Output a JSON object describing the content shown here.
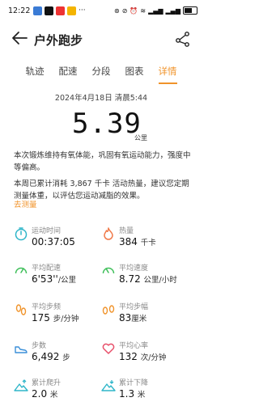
{
  "status_bar": {
    "time": "12:22",
    "battery_percent": 0.7
  },
  "header": {
    "title": "户外跑步"
  },
  "tabs": [
    {
      "label": "轨迹"
    },
    {
      "label": "配速"
    },
    {
      "label": "分段"
    },
    {
      "label": "图表"
    },
    {
      "label": "详情",
      "active": true
    }
  ],
  "summary": {
    "date_line": "2024年4月18日 清晨5:44",
    "distance": "5.39",
    "distance_unit": "公里",
    "paragraph1": "本次锻炼维持有氧体能，巩固有氧运动能力，强度中等偏高。",
    "paragraph2": "本周已累计消耗 3,867 千卡 活动热量，建议您定期测量体重，以评估您运动减脂的效果。",
    "link": "去测量"
  },
  "metrics": [
    {
      "label": "运动时间",
      "value": "00:37:05",
      "unit": "",
      "icon": "stopwatch-icon",
      "color": "#2fb6c9"
    },
    {
      "label": "热量",
      "value": "384",
      "unit": "千卡",
      "icon": "flame-icon",
      "color": "#f07a4a"
    },
    {
      "label": "平均配速",
      "value": "6'53''",
      "unit": "/公里",
      "icon": "pace-gauge-icon",
      "color": "#3fbf5a"
    },
    {
      "label": "平均速度",
      "value": "8.72",
      "unit": "公里/小时",
      "icon": "speed-gauge-icon",
      "color": "#3fbf5a"
    },
    {
      "label": "平均步频",
      "value": "175",
      "unit": "步/分钟",
      "icon": "footprints-icon",
      "color": "#f0932a"
    },
    {
      "label": "平均步幅",
      "value": "83",
      "unit": "厘米",
      "icon": "stride-icon",
      "color": "#f0932a"
    },
    {
      "label": "步数",
      "value": "6,492",
      "unit": "步",
      "icon": "shoe-icon",
      "color": "#3a8fd9"
    },
    {
      "label": "平均心率",
      "value": "132",
      "unit": "次/分钟",
      "icon": "heart-icon",
      "color": "#e8506a"
    },
    {
      "label": "累计爬升",
      "value": "2.0",
      "unit": "米",
      "icon": "mountain-up-icon",
      "color": "#2fb6c9"
    },
    {
      "label": "累计下降",
      "value": "1.3",
      "unit": "米",
      "icon": "mountain-down-icon",
      "color": "#2fb6c9"
    }
  ]
}
